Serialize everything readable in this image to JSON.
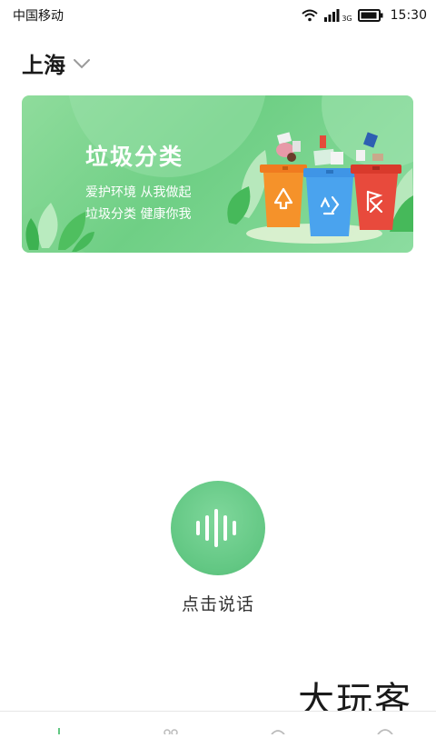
{
  "status_bar": {
    "carrier": "中国移动",
    "network": "3G",
    "time": "15:30",
    "icons": [
      "wifi-icon",
      "signal-icon",
      "battery-icon"
    ]
  },
  "location": {
    "city": "上海",
    "icon": "chevron-down-icon"
  },
  "banner": {
    "title": "垃圾分类",
    "line1": "爱护环境 从我做起",
    "line2": "垃圾分类 健康你我",
    "colors": {
      "bin_orange": "#f5922a",
      "bin_blue": "#4aa3ee",
      "bin_red": "#e84a3c"
    }
  },
  "voice": {
    "label": "点击说话",
    "icon": "sound-wave-icon"
  },
  "watermark": "大玩客",
  "colors": {
    "accent": "#62c783",
    "banner_green": "#6fcf85"
  }
}
